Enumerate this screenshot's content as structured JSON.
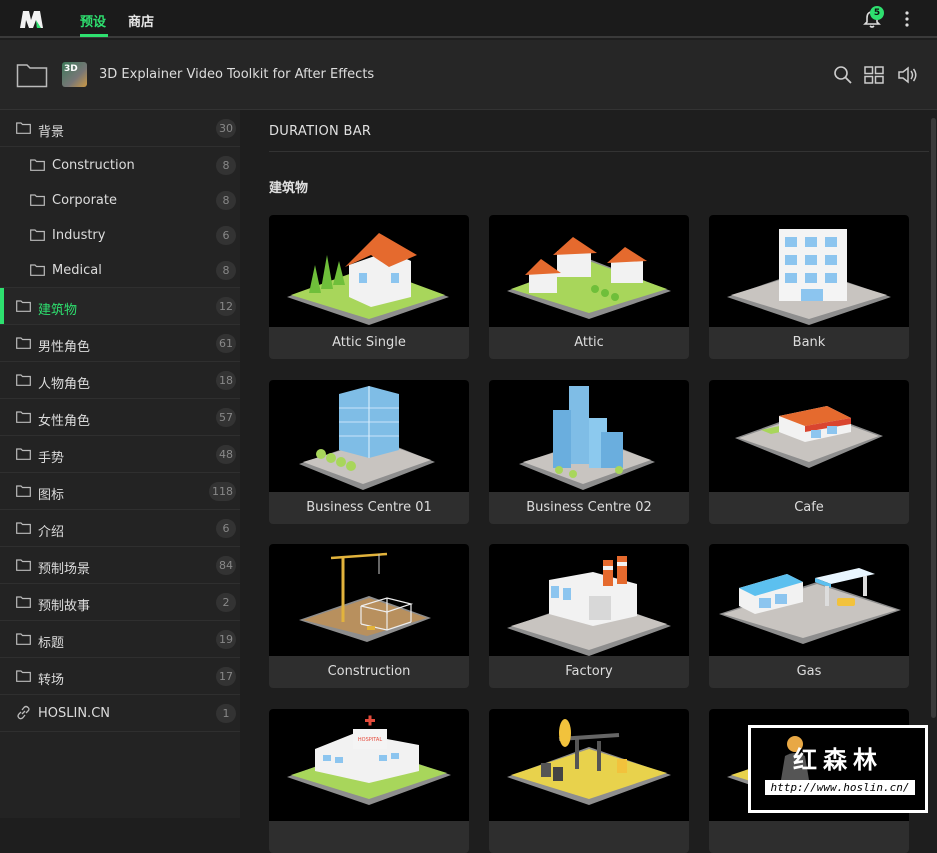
{
  "app": {
    "tabs": [
      {
        "label": "预设",
        "active": true
      },
      {
        "label": "商店",
        "active": false
      }
    ],
    "notification_count": "5",
    "accent_color": "#2ee06f"
  },
  "header": {
    "pack_thumb_text": "3D",
    "pack_title": "3D Explainer Video Toolkit for After Effects"
  },
  "sidebar": {
    "items": [
      {
        "label": "背景",
        "count": "30",
        "sub": false
      },
      {
        "label": "Construction",
        "count": "8",
        "sub": true
      },
      {
        "label": "Corporate",
        "count": "8",
        "sub": true
      },
      {
        "label": "Industry",
        "count": "6",
        "sub": true
      },
      {
        "label": "Medical",
        "count": "8",
        "sub": true
      },
      {
        "label": "建筑物",
        "count": "12",
        "sub": false,
        "active": true
      },
      {
        "label": "男性角色",
        "count": "61",
        "sub": false
      },
      {
        "label": "人物角色",
        "count": "18",
        "sub": false
      },
      {
        "label": "女性角色",
        "count": "57",
        "sub": false
      },
      {
        "label": "手势",
        "count": "48",
        "sub": false
      },
      {
        "label": "图标",
        "count": "118",
        "sub": false
      },
      {
        "label": "介绍",
        "count": "6",
        "sub": false
      },
      {
        "label": "预制场景",
        "count": "84",
        "sub": false
      },
      {
        "label": "预制故事",
        "count": "2",
        "sub": false
      },
      {
        "label": "标题",
        "count": "19",
        "sub": false
      },
      {
        "label": "转场",
        "count": "17",
        "sub": false
      },
      {
        "label": "HOSLIN.CN",
        "count": "1",
        "sub": false,
        "link": true
      }
    ]
  },
  "content": {
    "section_title": "DURATION BAR",
    "category_title": "建筑物",
    "cards": [
      {
        "name": "Attic Single",
        "icon": "house-icon"
      },
      {
        "name": "Attic",
        "icon": "houses-icon"
      },
      {
        "name": "Bank",
        "icon": "bank-icon"
      },
      {
        "name": "Business Centre 01",
        "icon": "office-tower-icon"
      },
      {
        "name": "Business Centre 02",
        "icon": "skyscrapers-icon"
      },
      {
        "name": "Cafe",
        "icon": "cafe-icon"
      },
      {
        "name": "Construction",
        "icon": "crane-icon"
      },
      {
        "name": "Factory",
        "icon": "factory-icon"
      },
      {
        "name": "Gas",
        "icon": "gas-station-icon"
      },
      {
        "name": "",
        "icon": "hospital-icon",
        "sign": "HOSPITAL"
      },
      {
        "name": "",
        "icon": "oil-pump-icon"
      },
      {
        "name": "",
        "icon": "building-icon"
      }
    ]
  },
  "watermark": {
    "title": "红森林",
    "url": "http://www.hoslin.cn/"
  }
}
